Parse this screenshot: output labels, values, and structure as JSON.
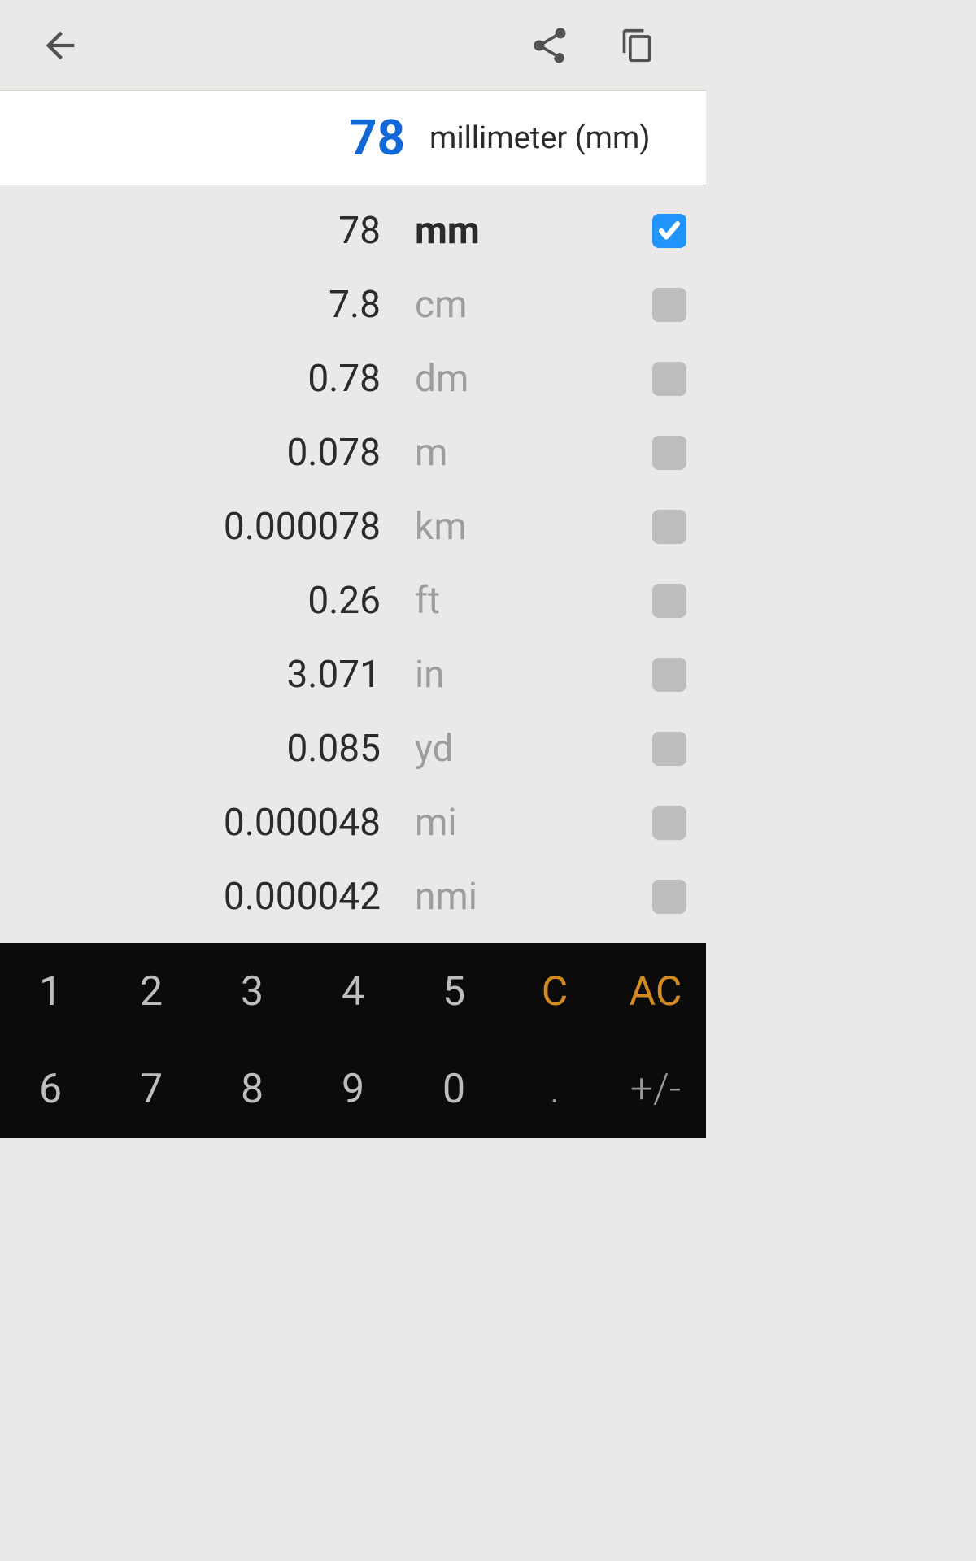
{
  "colors": {
    "accent": "#1168d6",
    "check": "#2094fb",
    "orange": "#d38a1f",
    "bg": "#eae9e7"
  },
  "header": {
    "back_icon": "arrow-left",
    "share_icon": "share",
    "copy_icon": "copy"
  },
  "input": {
    "value": "78",
    "unit_label": "millimeter (mm)"
  },
  "units": [
    {
      "value": "78",
      "unit": "mm",
      "selected": true
    },
    {
      "value": "7.8",
      "unit": "cm",
      "selected": false
    },
    {
      "value": "0.78",
      "unit": "dm",
      "selected": false
    },
    {
      "value": "0.078",
      "unit": "m",
      "selected": false
    },
    {
      "value": "0.000078",
      "unit": "km",
      "selected": false
    },
    {
      "value": "0.26",
      "unit": "ft",
      "selected": false
    },
    {
      "value": "3.071",
      "unit": "in",
      "selected": false
    },
    {
      "value": "0.085",
      "unit": "yd",
      "selected": false
    },
    {
      "value": "0.000048",
      "unit": "mi",
      "selected": false
    },
    {
      "value": "0.000042",
      "unit": "nmi",
      "selected": false
    }
  ],
  "keypad": {
    "keys": [
      {
        "label": "1",
        "style": "num"
      },
      {
        "label": "2",
        "style": "num"
      },
      {
        "label": "3",
        "style": "num"
      },
      {
        "label": "4",
        "style": "num"
      },
      {
        "label": "5",
        "style": "num"
      },
      {
        "label": "C",
        "style": "orange"
      },
      {
        "label": "AC",
        "style": "orange"
      },
      {
        "label": "6",
        "style": "num"
      },
      {
        "label": "7",
        "style": "num"
      },
      {
        "label": "8",
        "style": "num"
      },
      {
        "label": "9",
        "style": "num"
      },
      {
        "label": "0",
        "style": "num"
      },
      {
        "label": ".",
        "style": "dim"
      },
      {
        "label": "+/-",
        "style": "dim"
      }
    ]
  }
}
